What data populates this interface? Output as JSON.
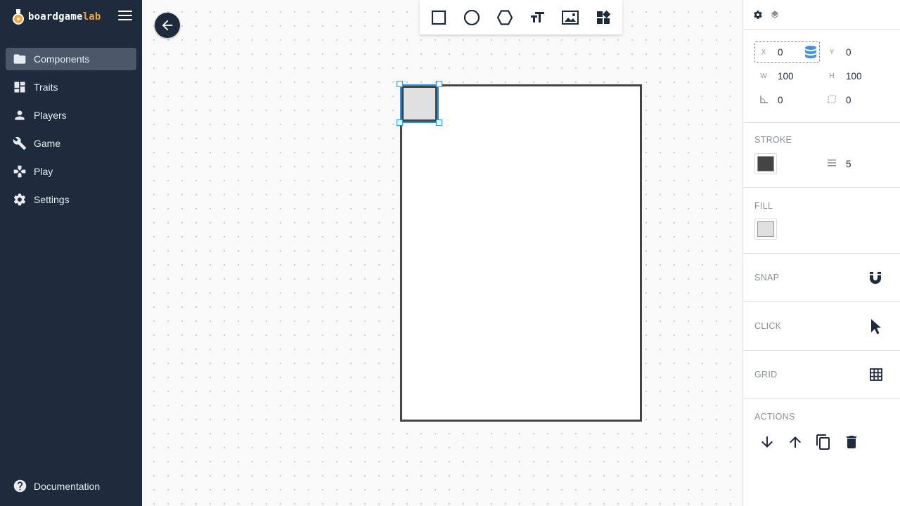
{
  "brand": {
    "part1": "boardgame",
    "part2": "lab"
  },
  "nav": [
    {
      "label": "Components",
      "icon": "folder-icon",
      "active": true
    },
    {
      "label": "Traits",
      "icon": "dashboard-icon"
    },
    {
      "label": "Players",
      "icon": "person-icon"
    },
    {
      "label": "Game",
      "icon": "wrench-icon"
    },
    {
      "label": "Play",
      "icon": "gamepad-icon"
    },
    {
      "label": "Settings",
      "icon": "gear-icon"
    }
  ],
  "documentation": "Documentation",
  "toolbar": {
    "tools": [
      "square-tool",
      "circle-tool",
      "hexagon-tool",
      "text-tool",
      "image-tool",
      "component-tool"
    ]
  },
  "properties": {
    "x_label": "X",
    "x": "0",
    "y_label": "Y",
    "y": "0",
    "w_label": "W",
    "w": "100",
    "h_label": "H",
    "h": "100",
    "rotation": "0",
    "radius": "0",
    "stroke_label": "STROKE",
    "stroke_color": "#444444",
    "stroke_width": "5",
    "fill_label": "FILL",
    "fill_color": "#e0e0e0",
    "snap_label": "SNAP",
    "click_label": "CLICK",
    "grid_label": "GRID",
    "actions_label": "ACTIONS"
  },
  "colors": {
    "sidebar": "#1e2b3c",
    "accent": "#2196f3",
    "brand_accent": "#f2a33a"
  }
}
